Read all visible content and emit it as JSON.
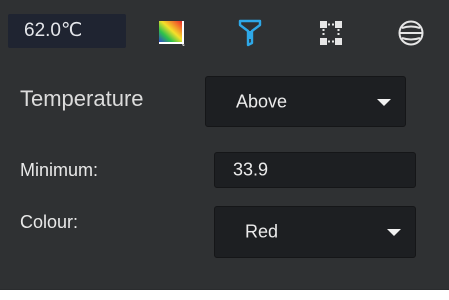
{
  "toolbar": {
    "temperature_readout": "62.0℃",
    "icons": [
      "palette-icon",
      "filter-icon",
      "grid-select-icon",
      "sphere-icon"
    ]
  },
  "form": {
    "mode": {
      "label": "Temperature",
      "selected": "Above"
    },
    "minimum": {
      "label": "Minimum:",
      "value": "33.9"
    },
    "colour": {
      "label": "Colour:",
      "selected": "Red"
    }
  },
  "colors": {
    "panel_bg": "#2f3133",
    "readout_bg": "#1f2431",
    "control_bg": "#1d1f22",
    "accent": "#2ea8e8"
  }
}
